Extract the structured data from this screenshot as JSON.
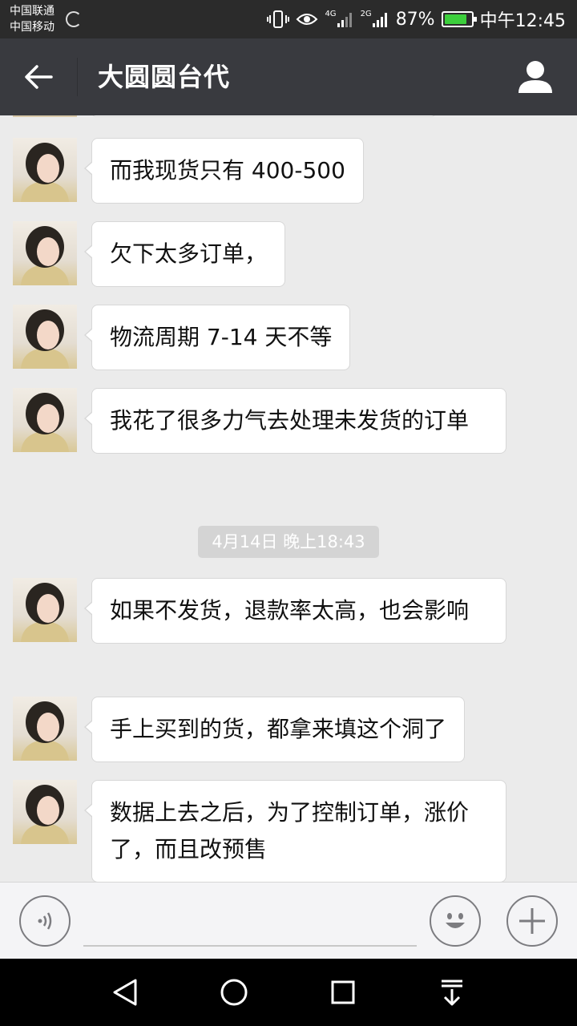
{
  "status_bar": {
    "carrier_1": "中国联通",
    "carrier_2": "中国移动",
    "network_1": "4G",
    "network_2": "2G",
    "battery_percent": "87%",
    "time": "中午12:45",
    "battery_color": "#3ccf3c"
  },
  "header": {
    "title": "大圆圆台代",
    "back_icon": "back-arrow-icon",
    "profile_icon": "person-icon"
  },
  "messages": [
    {
      "text": "而我现货只有 400-500"
    },
    {
      "text": "欠下太多订单，"
    },
    {
      "text": "物流周期 7-14 天不等"
    },
    {
      "text": "我花了很多力气去处理未发货的订单"
    },
    {
      "text": "如果不发货，退款率太高，也会影响"
    },
    {
      "text": "手上买到的货，都拿来填这个洞了"
    },
    {
      "text": "数据上去之后，为了控制订单，涨价了，而且改预售"
    }
  ],
  "timestamp": "4月14日 晚上18:43",
  "input_bar": {
    "voice_icon": "voice-icon",
    "input_value": "",
    "emoji_icon": "emoji-icon",
    "plus_icon": "plus-icon"
  },
  "nav_bar": {
    "back_icon": "nav-back-icon",
    "home_icon": "nav-home-icon",
    "recents_icon": "nav-recents-icon",
    "notifications_icon": "nav-pulldown-icon"
  },
  "colors": {
    "title_bar": "#393a3f",
    "chat_background": "#ebebeb",
    "bubble": "#ffffff"
  }
}
